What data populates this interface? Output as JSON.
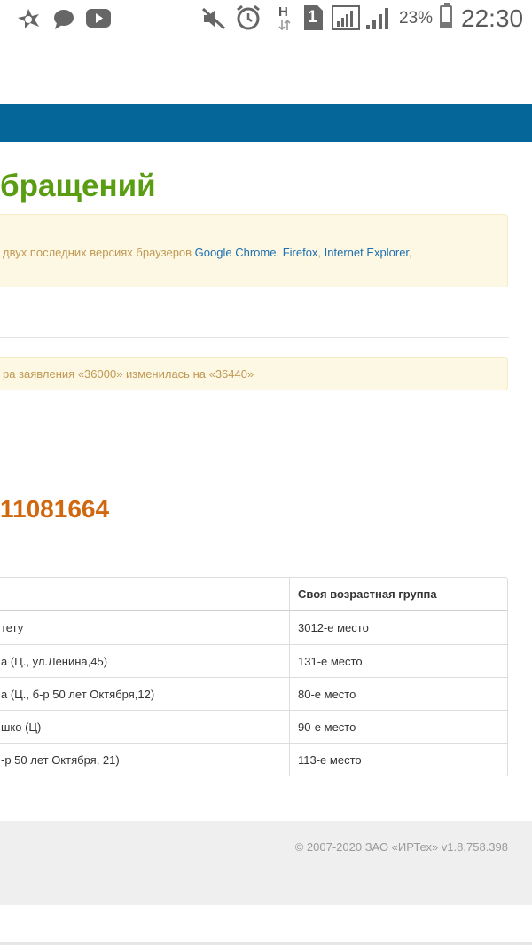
{
  "status_bar": {
    "battery_percent": "23%",
    "battery_level": 0.23,
    "time": "22:30",
    "sim_slot": "1",
    "network_type": "H",
    "icons_left": [
      "avast-icon",
      "chat-bubble-icon",
      "youtube-icon"
    ],
    "icons_right": [
      "muted-icon",
      "alarm-clock-icon",
      "network-h-icon",
      "sim-1-icon",
      "signal-bars-icon",
      "signal-bars-icon",
      "battery-icon"
    ]
  },
  "page": {
    "title": "бращений",
    "notice_browsers": {
      "prefix": "двух последних версиях браузеров ",
      "links": [
        "Google Chrome",
        "Firefox",
        "Internet Explorer"
      ],
      "sep1": ", ",
      "sep2": ", ",
      "suffix": ","
    },
    "notice_price": "ра заявления «36000» изменилась на «36440»",
    "application_number": "11081664"
  },
  "table": {
    "headers": [
      "",
      "Своя возрастная группа"
    ],
    "rows": [
      [
        "тету",
        "3012-е место"
      ],
      [
        "а (Ц., ул.Ленина,45)",
        "131-е место"
      ],
      [
        "а (Ц., б-р 50 лет Октября,12)",
        "80-е место"
      ],
      [
        "шко (Ц)",
        "90-е место"
      ],
      [
        "-р 50 лет Октября, 21)",
        "113-е место"
      ]
    ]
  },
  "footer": {
    "copyright": "© 2007-2020 ЗАО «ИРТех» v1.8.758.398"
  },
  "colors": {
    "nav": "#046699",
    "title_green": "#5a9c12",
    "number_orange": "#d0680f",
    "notice_bg": "#fcf8e3",
    "notice_text": "#c09853",
    "link": "#1d6fb0"
  }
}
